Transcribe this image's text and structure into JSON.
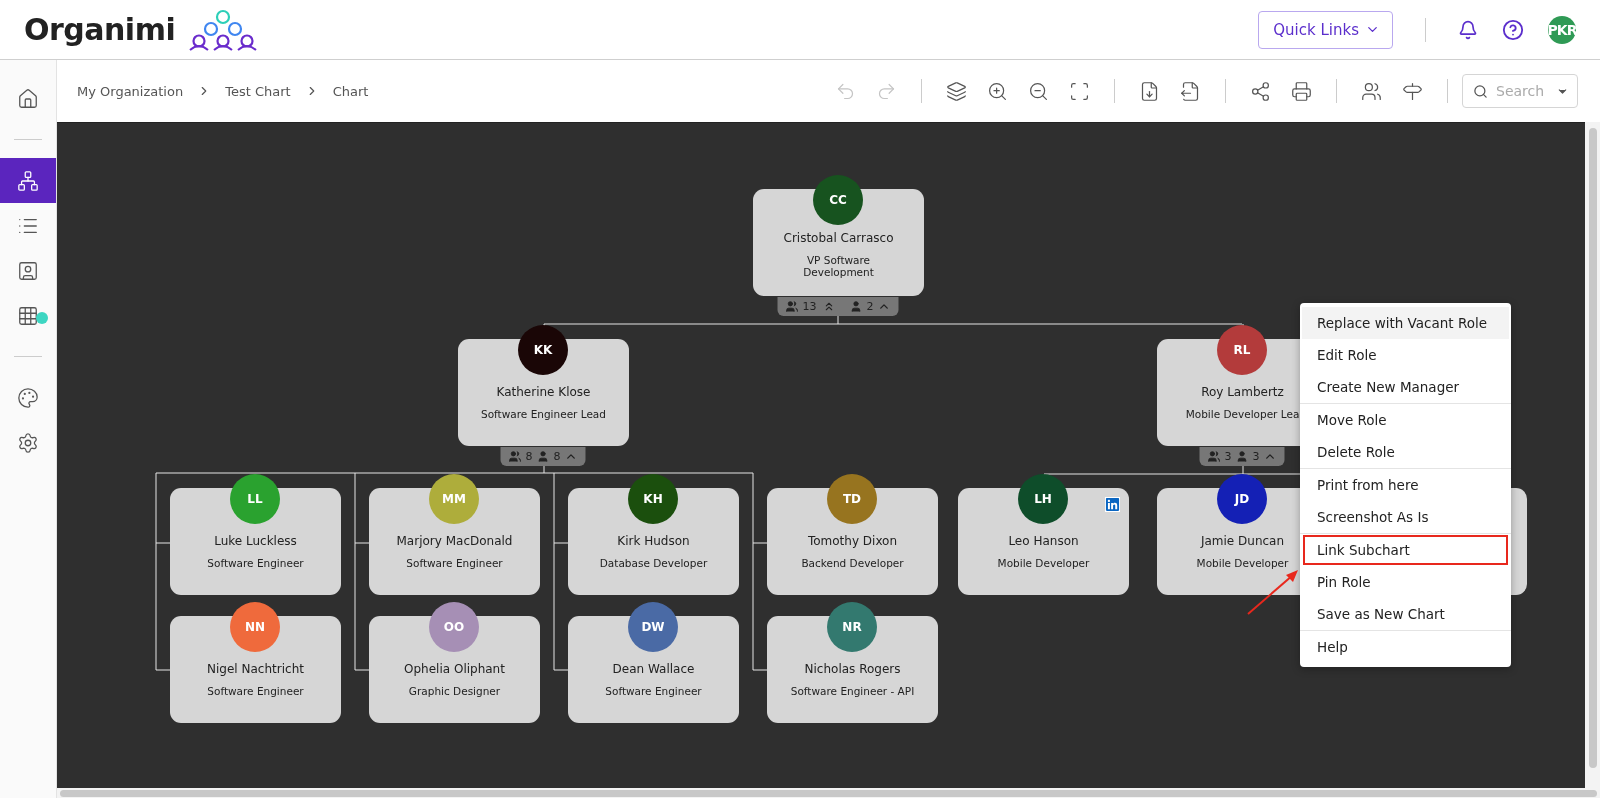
{
  "header": {
    "logo": "Organimi",
    "quick_links": "Quick Links",
    "user_initials": "PKR"
  },
  "sidebar": {
    "items": [
      {
        "kind": "home",
        "selected": false
      },
      {
        "kind": "divider"
      },
      {
        "kind": "chart",
        "selected": true
      },
      {
        "kind": "list",
        "selected": false
      },
      {
        "kind": "directory",
        "selected": false
      },
      {
        "kind": "grid",
        "selected": false,
        "badge": true
      },
      {
        "kind": "divider"
      },
      {
        "kind": "palette",
        "selected": false
      },
      {
        "kind": "settings",
        "selected": false
      }
    ]
  },
  "breadcrumbs": [
    "My Organization",
    "Test Chart",
    "Chart"
  ],
  "toolbar": {
    "groups": [
      [
        {
          "kind": "undo",
          "disabled": true
        },
        {
          "kind": "redo",
          "disabled": true
        }
      ],
      [
        {
          "kind": "layers",
          "disabled": false
        },
        {
          "kind": "zoom_in",
          "disabled": false
        },
        {
          "kind": "zoom_out",
          "disabled": false
        },
        {
          "kind": "fit",
          "disabled": false
        }
      ],
      [
        {
          "kind": "import",
          "disabled": false
        },
        {
          "kind": "export",
          "disabled": false
        }
      ],
      [
        {
          "kind": "share",
          "disabled": false
        },
        {
          "kind": "print",
          "disabled": false
        }
      ],
      [
        {
          "kind": "people",
          "disabled": false
        },
        {
          "kind": "signpost",
          "disabled": false
        }
      ]
    ],
    "search": {
      "placeholder": "Search"
    }
  },
  "chart": {
    "root": {
      "initials": "CC",
      "name": "Cristobal Carrasco",
      "title": "VP Software Development",
      "color": "#17531f",
      "counts": {
        "team": "13",
        "direct": "2",
        "collapse_all": true,
        "expanded": true
      },
      "children": [
        {
          "initials": "KK",
          "name": "Katherine Klose",
          "title": "Software Engineer Lead",
          "color": "#1a0606",
          "counts": {
            "team": "8",
            "direct": "8",
            "collapse_all": false,
            "expanded": true
          },
          "children": [
            {
              "initials": "LL",
              "name": "Luke Luckless",
              "title": "Software Engineer",
              "color": "#2aa22f"
            },
            {
              "initials": "MM",
              "name": "Marjory MacDonald",
              "title": "Software Engineer",
              "color": "#aead3b"
            },
            {
              "initials": "KH",
              "name": "Kirk Hudson",
              "title": "Database Developer",
              "color": "#1b4f0d"
            },
            {
              "initials": "TD",
              "name": "Tomothy Dixon",
              "title": "Backend Developer",
              "color": "#97741f"
            },
            {
              "initials": "NN",
              "name": "Nigel Nachtricht",
              "title": "Software Engineer",
              "color": "#ef6a3c"
            },
            {
              "initials": "OO",
              "name": "Ophelia Oliphant",
              "title": "Graphic Designer",
              "color": "#a68fb5"
            },
            {
              "initials": "DW",
              "name": "Dean Wallace",
              "title": "Software Engineer",
              "color": "#4a6aa5"
            },
            {
              "initials": "NR",
              "name": "Nicholas Rogers",
              "title": "Software Engineer - API",
              "color": "#33796f"
            }
          ]
        },
        {
          "initials": "RL",
          "name": "Roy Lambertz",
          "title": "Mobile Developer Lea",
          "color": "#b33b3b",
          "counts": {
            "team": "3",
            "direct": "3",
            "collapse_all": false,
            "expanded": true
          },
          "children": [
            {
              "initials": "LH",
              "name": "Leo Hanson",
              "title": "Mobile Developer",
              "color": "#0e4d2a",
              "linkedin": true
            },
            {
              "initials": "JD",
              "name": "Jamie Duncan",
              "title": "Mobile Developer",
              "color": "#1420b5"
            }
          ]
        }
      ]
    }
  },
  "context_menu": {
    "groups": [
      [
        {
          "label": "Replace with Vacant Role",
          "hovered": true,
          "annotated": false
        },
        {
          "label": "Edit Role",
          "hovered": false,
          "annotated": false
        },
        {
          "label": "Create New Manager",
          "hovered": false,
          "annotated": false
        }
      ],
      [
        {
          "label": "Move Role",
          "hovered": false,
          "annotated": false
        },
        {
          "label": "Delete Role",
          "hovered": false,
          "annotated": false
        }
      ],
      [
        {
          "label": "Print from here",
          "hovered": false,
          "annotated": false
        },
        {
          "label": "Screenshot As Is",
          "hovered": false,
          "annotated": false
        }
      ],
      [
        {
          "label": "Link Subchart",
          "hovered": false,
          "annotated": true
        },
        {
          "label": "Pin Role",
          "hovered": false,
          "annotated": false
        },
        {
          "label": "Save as New Chart",
          "hovered": false,
          "annotated": false
        }
      ],
      [
        {
          "label": "Help",
          "hovered": false,
          "annotated": false
        }
      ]
    ]
  }
}
